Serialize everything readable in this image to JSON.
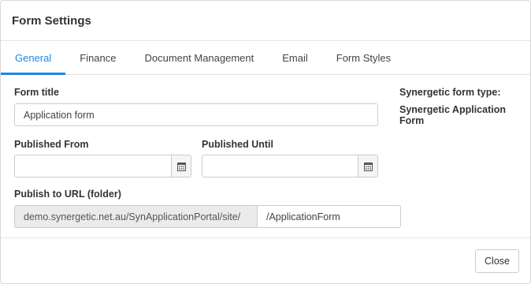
{
  "dialog": {
    "title": "Form Settings"
  },
  "tabs": [
    {
      "label": "General",
      "active": true
    },
    {
      "label": "Finance",
      "active": false
    },
    {
      "label": "Document Management",
      "active": false
    },
    {
      "label": "Email",
      "active": false
    },
    {
      "label": "Form Styles",
      "active": false
    }
  ],
  "form": {
    "title_label": "Form title",
    "title_value": "Application form",
    "published_from_label": "Published From",
    "published_from_value": "",
    "published_until_label": "Published Until",
    "published_until_value": "",
    "url_label": "Publish to URL (folder)",
    "url_prefix": "demo.synergetic.net.au/SynApplicationPortal/site/",
    "url_value": "/ApplicationForm"
  },
  "side": {
    "type_label": "Synergetic form type:",
    "type_value": "Synergetic Application Form"
  },
  "footer": {
    "close_label": "Close"
  },
  "colors": {
    "accent": "#1e88e5"
  },
  "icons": {
    "calendar": "calendar-icon"
  }
}
